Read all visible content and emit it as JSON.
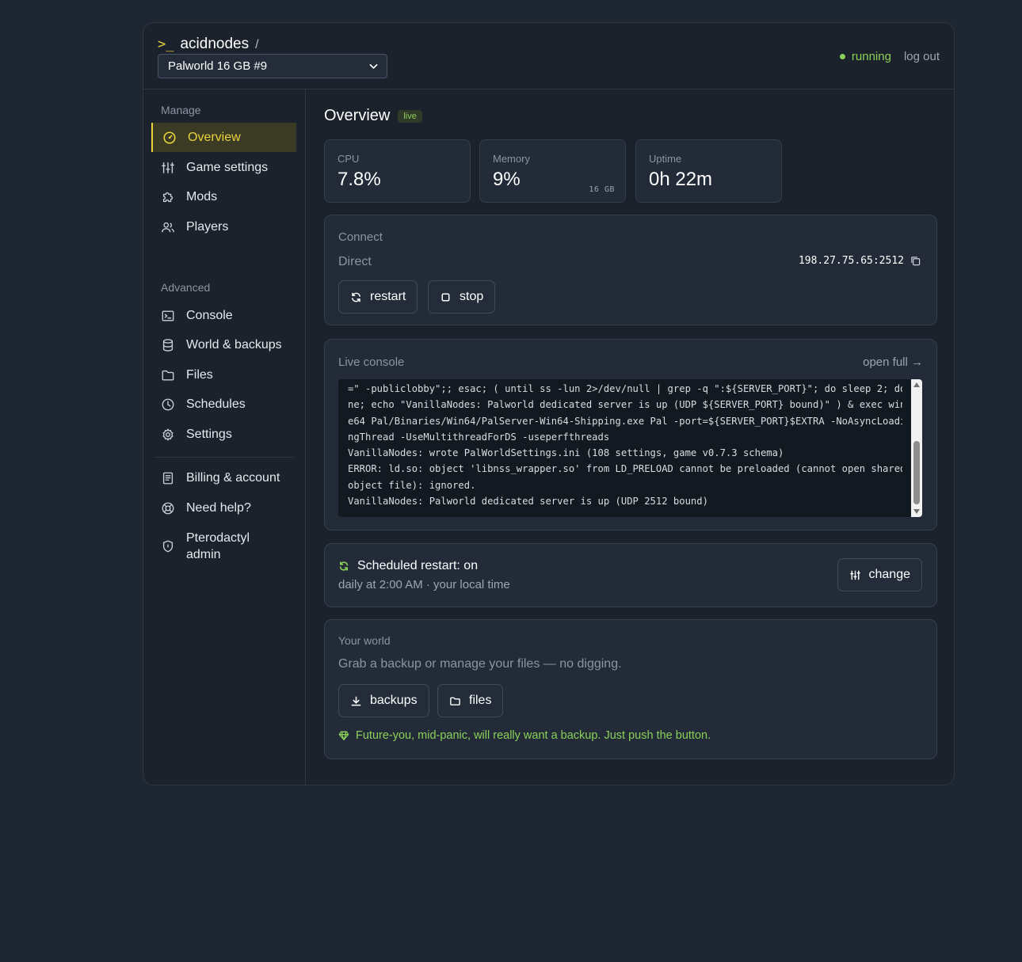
{
  "header": {
    "prompt": ">_",
    "brand": "acidnodes",
    "separator": "/",
    "server_selected": "Palworld 16 GB #9",
    "status": "running",
    "logout": "log out"
  },
  "sidebar": {
    "manage_label": "Manage",
    "advanced_label": "Advanced",
    "manage_items": [
      {
        "label": "Overview",
        "icon": "gauge-icon"
      },
      {
        "label": "Game settings",
        "icon": "sliders-icon"
      },
      {
        "label": "Mods",
        "icon": "puzzle-icon"
      },
      {
        "label": "Players",
        "icon": "users-icon"
      }
    ],
    "advanced_items": [
      {
        "label": "Console",
        "icon": "terminal-icon"
      },
      {
        "label": "World & backups",
        "icon": "database-icon"
      },
      {
        "label": "Files",
        "icon": "folder-icon"
      },
      {
        "label": "Schedules",
        "icon": "clock-icon"
      },
      {
        "label": "Settings",
        "icon": "gear-icon"
      }
    ],
    "account_items": [
      {
        "label": "Billing & account",
        "icon": "receipt-icon"
      },
      {
        "label": "Need help?",
        "icon": "lifebuoy-icon"
      },
      {
        "label": "Pterodactyl admin",
        "icon": "shield-icon"
      }
    ]
  },
  "overview": {
    "title": "Overview",
    "badge": "live",
    "stats": [
      {
        "label": "CPU",
        "value": "7.8%",
        "sub": ""
      },
      {
        "label": "Memory",
        "value": "9%",
        "sub": "16 GB"
      },
      {
        "label": "Uptime",
        "value": "0h 22m",
        "sub": ""
      }
    ]
  },
  "connect": {
    "label": "Connect",
    "direct_label": "Direct",
    "address": "198.27.75.65:2512",
    "restart": "restart",
    "stop": "stop"
  },
  "console": {
    "label": "Live console",
    "open_full": "open full →",
    "lines": [
      "=\" -publiclobby\";; esac; ( until ss -lun 2>/dev/null | grep -q \":${SERVER_PORT}\"; do sleep 2; do",
      "ne; echo \"VanillaNodes: Palworld dedicated server is up (UDP ${SERVER_PORT} bound)\" ) & exec win",
      "e64 Pal/Binaries/Win64/PalServer-Win64-Shipping.exe Pal -port=${SERVER_PORT}$EXTRA -NoAsyncLoadi",
      "ngThread -UseMultithreadForDS -useperfthreads",
      "VanillaNodes: wrote PalWorldSettings.ini (108 settings, game v0.7.3 schema)",
      "ERROR: ld.so: object 'libnss_wrapper.so' from LD_PRELOAD cannot be preloaded (cannot open shared",
      "object file): ignored.",
      "VanillaNodes: Palworld dedicated server is up (UDP 2512 bound)"
    ]
  },
  "schedule": {
    "title": "Scheduled restart: on",
    "subtitle": "daily at 2:00 AM · your local time",
    "change": "change"
  },
  "world": {
    "label": "Your world",
    "description": "Grab a backup or manage your files — no digging.",
    "backups": "backups",
    "files": "files",
    "hint": "Future-you, mid-panic, will really want a backup. Just push the button."
  },
  "colors": {
    "accent": "#e9d43a",
    "success": "#8bd05a",
    "background": "#1e2631",
    "panel": "#222b37"
  }
}
